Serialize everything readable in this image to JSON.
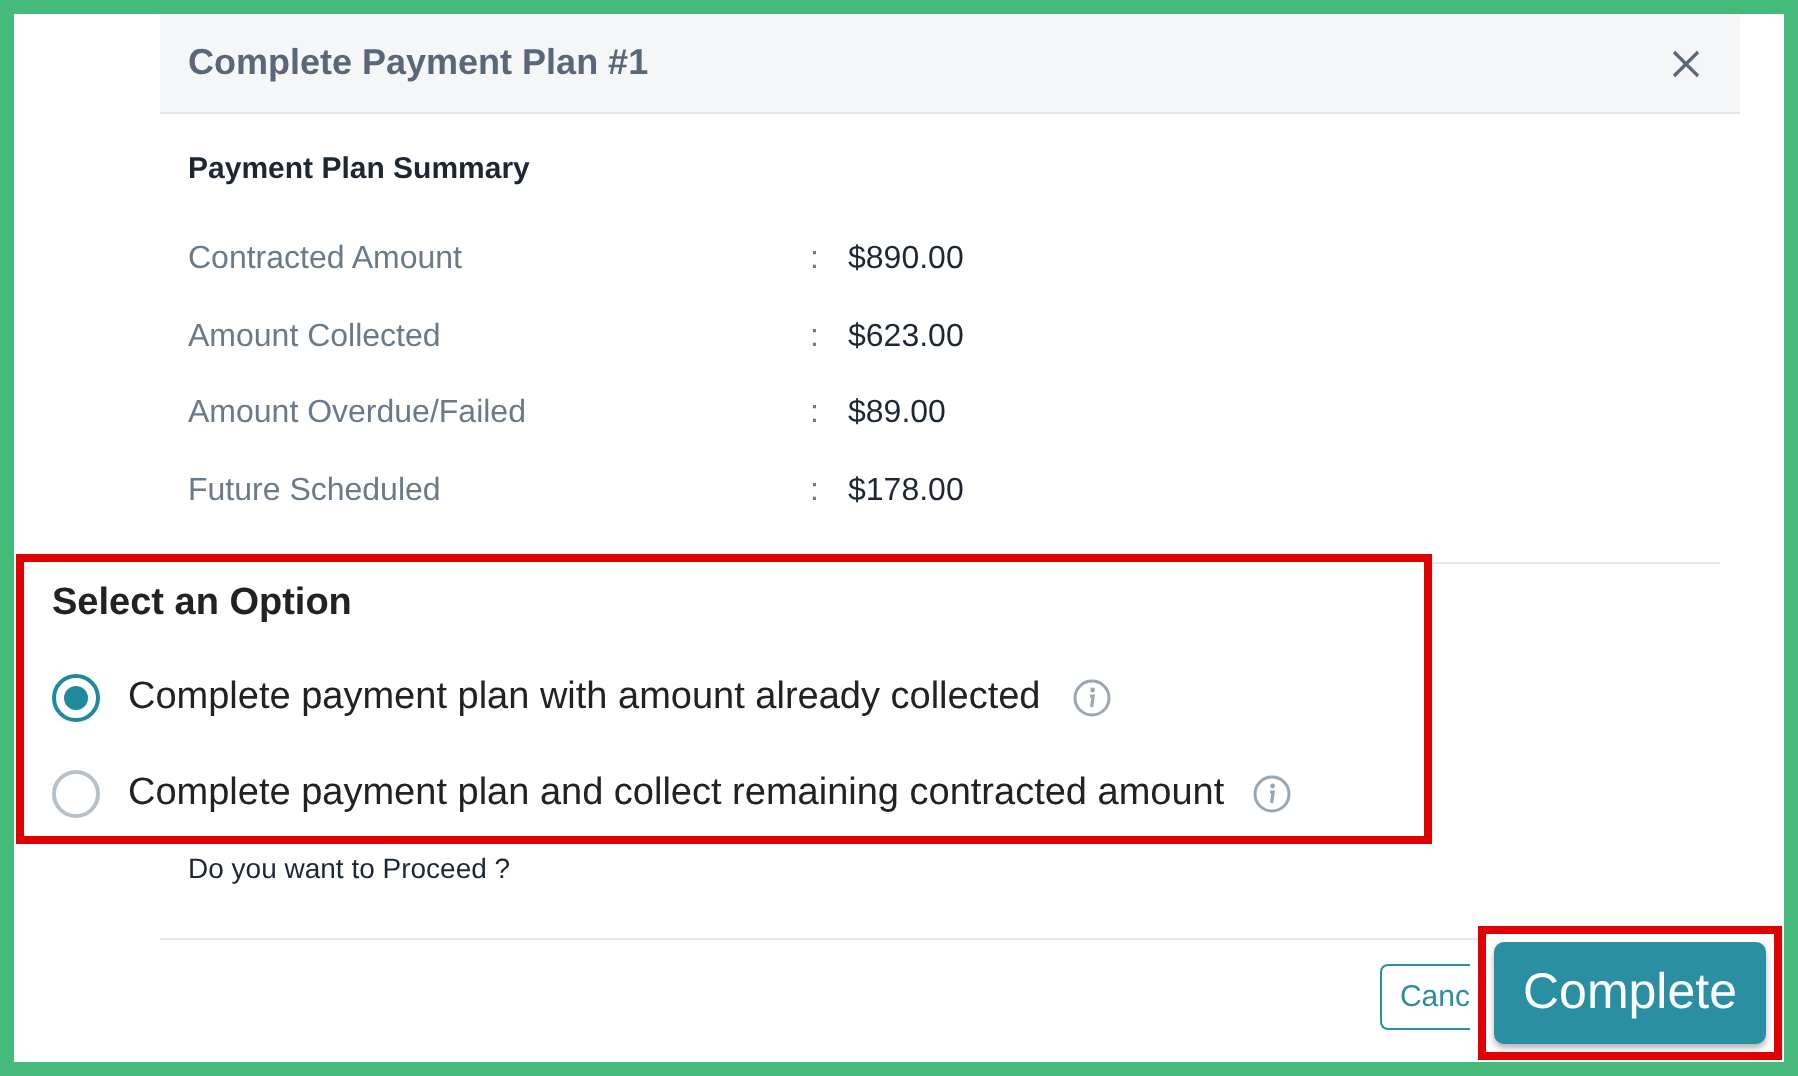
{
  "dialog": {
    "title": "Complete Payment Plan #1"
  },
  "summary": {
    "heading": "Payment Plan Summary",
    "rows": [
      {
        "label": "Contracted Amount",
        "separator": ":",
        "value": "$890.00"
      },
      {
        "label": "Amount Collected",
        "separator": ":",
        "value": "$623.00"
      },
      {
        "label": "Amount Overdue/Failed",
        "separator": ":",
        "value": "$89.00"
      },
      {
        "label": "Future Scheduled",
        "separator": ":",
        "value": "$178.00"
      }
    ]
  },
  "option_panel": {
    "heading": "Select an Option",
    "options": [
      {
        "label": "Complete payment plan with amount already collected",
        "selected": true
      },
      {
        "label": "Complete payment plan and collect remaining contracted amount",
        "selected": false
      }
    ]
  },
  "prompt": "Do you want to Proceed ?",
  "buttons": [
    {
      "label": "Canc",
      "kind": "secondary"
    },
    {
      "label": "Complete",
      "kind": "primary"
    }
  ]
}
